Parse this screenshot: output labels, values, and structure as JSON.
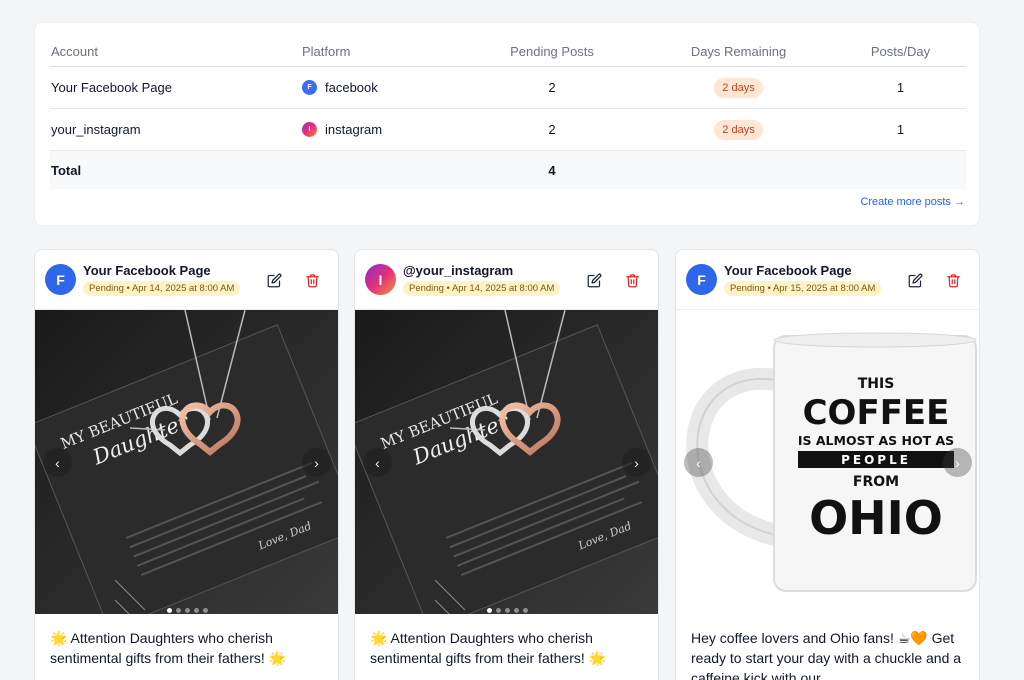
{
  "summary": {
    "headers": {
      "account": "Account",
      "platform": "Platform",
      "pending": "Pending Posts",
      "days": "Days Remaining",
      "ppd": "Posts/Day"
    },
    "rows": [
      {
        "account": "Your Facebook Page",
        "platform": "facebook",
        "platform_letter": "F",
        "pending": "2",
        "days": "2 days",
        "ppd": "1"
      },
      {
        "account": "your_instagram",
        "platform": "instagram",
        "platform_letter": "I",
        "pending": "2",
        "days": "2 days",
        "ppd": "1"
      }
    ],
    "total_label": "Total",
    "total_pending": "4",
    "create_link": "Create more posts →"
  },
  "posts": [
    {
      "avatar_letter": "F",
      "account": "Your Facebook Page",
      "status": "Pending • Apr 14, 2025 at 8:00 AM",
      "text": "🌟 Attention Daughters who cherish sentimental gifts from their fathers! 🌟",
      "image": {
        "line1": "MY BEAUTIFUL",
        "line2": "Daughter",
        "sign": "Love, Dad"
      }
    },
    {
      "avatar_letter": "I",
      "account": "@your_instagram",
      "status": "Pending • Apr 14, 2025 at 8:00 AM",
      "text": "🌟 Attention Daughters who cherish sentimental gifts from their fathers! 🌟",
      "image": {
        "line1": "MY BEAUTIFUL",
        "line2": "Daughter",
        "sign": "Love, Dad"
      }
    },
    {
      "avatar_letter": "F",
      "account": "Your Facebook Page",
      "status": "Pending • Apr 15, 2025 at 8:00 AM",
      "text": "Hey coffee lovers and Ohio fans! ☕🧡 Get ready to start your day with a chuckle and a caffeine kick with our",
      "image": {
        "this": "THIS",
        "coffee": "COFFEE",
        "almost": "IS ALMOST AS HOT AS",
        "people": "PEOPLE",
        "from": "FROM",
        "ohio": "OHIO"
      }
    }
  ],
  "colors": {
    "accent": "#2563eb",
    "facebook": "#2f67eb",
    "pending_badge": "#fdf3c7",
    "days_badge": "#fde7d4",
    "delete": "#dc2626"
  },
  "icons": {
    "edit": "edit-icon",
    "delete": "trash-icon",
    "prev": "chevron-left-icon",
    "next": "chevron-right-icon"
  }
}
